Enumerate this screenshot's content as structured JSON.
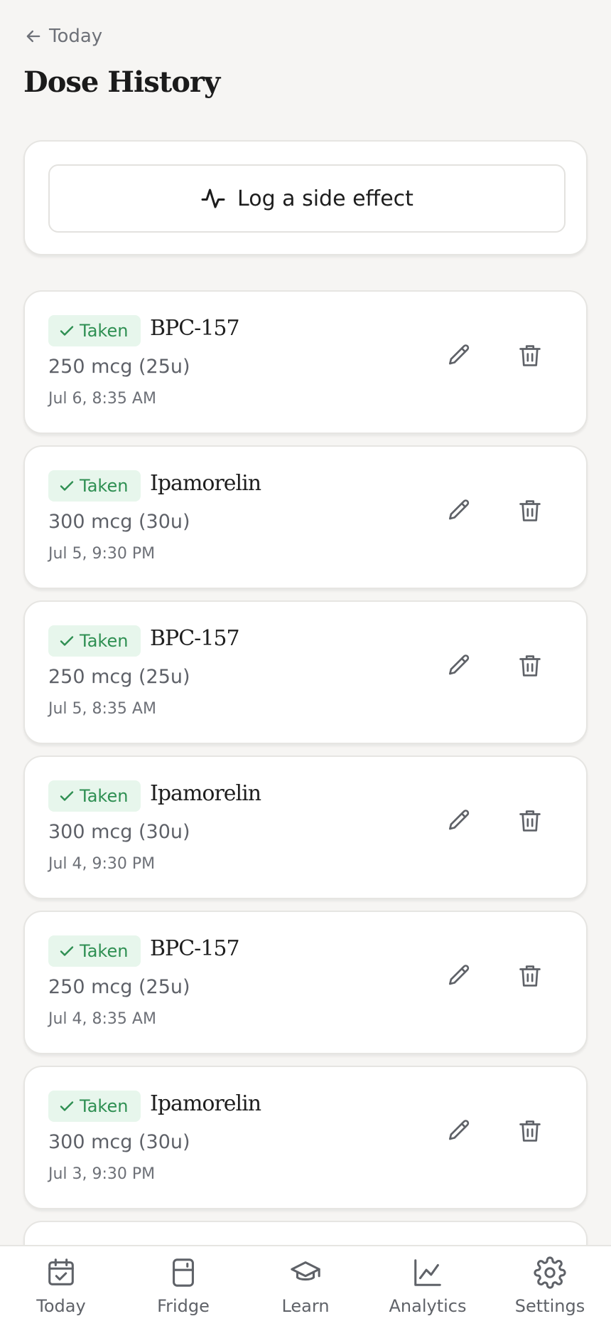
{
  "header": {
    "back_label": "Today",
    "title": "Dose History"
  },
  "actions": {
    "log_side_effect_label": "Log a side effect"
  },
  "doses": [
    {
      "status": "Taken",
      "medication": "BPC-157",
      "amount": "250 mcg (25u)",
      "time": "Jul 6, 8:35 AM"
    },
    {
      "status": "Taken",
      "medication": "Ipamorelin",
      "amount": "300 mcg (30u)",
      "time": "Jul 5, 9:30 PM"
    },
    {
      "status": "Taken",
      "medication": "BPC-157",
      "amount": "250 mcg (25u)",
      "time": "Jul 5, 8:35 AM"
    },
    {
      "status": "Taken",
      "medication": "Ipamorelin",
      "amount": "300 mcg (30u)",
      "time": "Jul 4, 9:30 PM"
    },
    {
      "status": "Taken",
      "medication": "BPC-157",
      "amount": "250 mcg (25u)",
      "time": "Jul 4, 8:35 AM"
    },
    {
      "status": "Taken",
      "medication": "Ipamorelin",
      "amount": "300 mcg (30u)",
      "time": "Jul 3, 9:30 PM"
    }
  ],
  "tabs": [
    {
      "label": "Today",
      "icon": "calendar-check-icon"
    },
    {
      "label": "Fridge",
      "icon": "fridge-icon"
    },
    {
      "label": "Learn",
      "icon": "graduation-cap-icon"
    },
    {
      "label": "Analytics",
      "icon": "line-chart-icon"
    },
    {
      "label": "Settings",
      "icon": "gear-icon"
    }
  ],
  "colors": {
    "accent_green": "#2e8f52",
    "badge_bg": "#e7f6ec",
    "background": "#f6f5f3"
  }
}
